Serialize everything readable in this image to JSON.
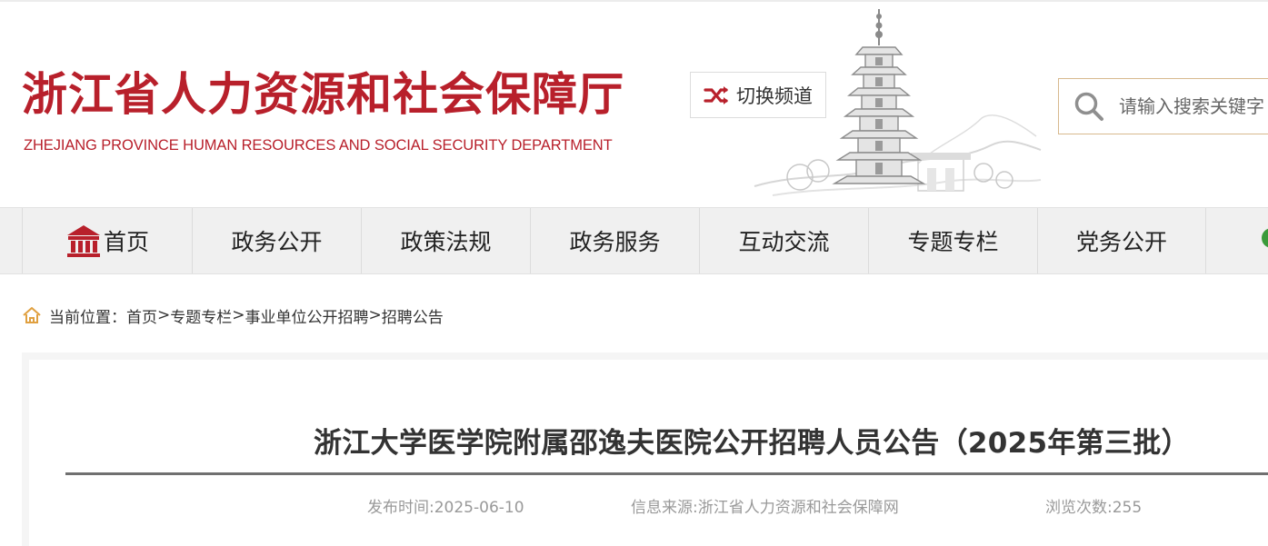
{
  "header": {
    "logo_cn": "浙江省人力资源和社会保障厅",
    "logo_en": "ZHEJIANG PROVINCE HUMAN RESOURCES AND SOCIAL SECURITY DEPARTMENT",
    "switch_channel": "切换频道",
    "search_placeholder": "请输入搜索关键字"
  },
  "nav": {
    "items": [
      {
        "label": "首页",
        "icon": "home-building-icon"
      },
      {
        "label": "政务公开"
      },
      {
        "label": "政策法规"
      },
      {
        "label": "政务服务"
      },
      {
        "label": "互动交流"
      },
      {
        "label": "专题专栏"
      },
      {
        "label": "党务公开"
      }
    ]
  },
  "breadcrumb": {
    "prefix": "当前位置：",
    "items": [
      "首页",
      "专题专栏",
      "事业单位公开招聘",
      "招聘公告"
    ],
    "separator": ">"
  },
  "article": {
    "title": "浙江大学医学院附属邵逸夫医院公开招聘人员公告（2025年第三批）",
    "publish_time": "发布时间:2025-06-10",
    "source": "信息来源:浙江省人力资源和社会保障网",
    "views": "浏览次数:255"
  },
  "colors": {
    "brand_red": "#b8202b",
    "nav_bg": "#f0f0f0",
    "search_border": "#d8b98e",
    "breadcrumb_icon": "#e0a040",
    "meta_text": "#999999"
  }
}
